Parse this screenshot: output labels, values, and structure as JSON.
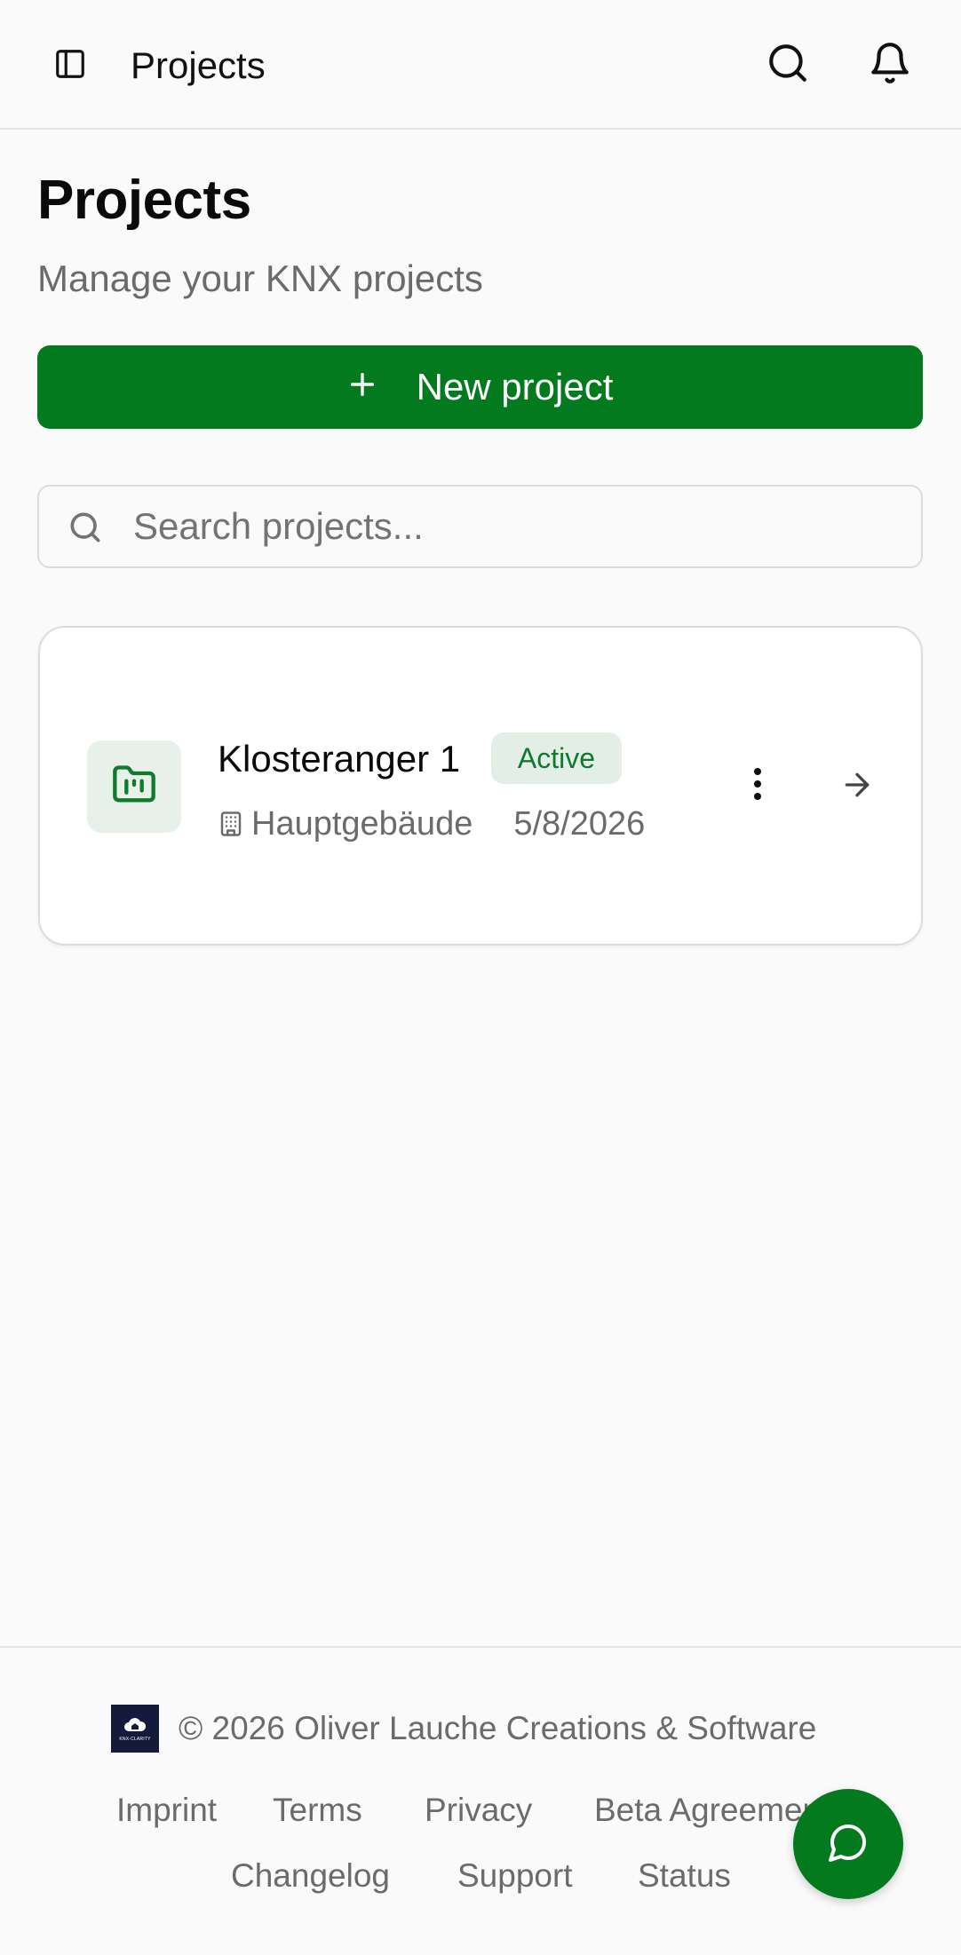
{
  "header": {
    "title": "Projects",
    "icons": {
      "sidebar": "sidebar-toggle-icon",
      "search": "search-icon",
      "notifications": "bell-icon"
    }
  },
  "page": {
    "title": "Projects",
    "subtitle": "Manage your KNX projects",
    "new_project_label": "New project",
    "search_placeholder": "Search projects..."
  },
  "projects": [
    {
      "name": "Klosteranger 1",
      "status": "Active",
      "building": "Hauptgebäude",
      "date": "5/8/2026"
    }
  ],
  "footer": {
    "copyright": "© 2026 Oliver Lauche Creations & Software",
    "logo_text": "KNX-CLARITY",
    "links_row1": [
      "Imprint",
      "Terms",
      "Privacy",
      "Beta Agreement"
    ],
    "links_row2": [
      "Changelog",
      "Support",
      "Status"
    ]
  },
  "colors": {
    "accent": "#037a1d",
    "badge_bg": "#e3efe6",
    "badge_text": "#0f7a2c",
    "muted_text": "#6b6b6b",
    "background": "#fafafa"
  }
}
